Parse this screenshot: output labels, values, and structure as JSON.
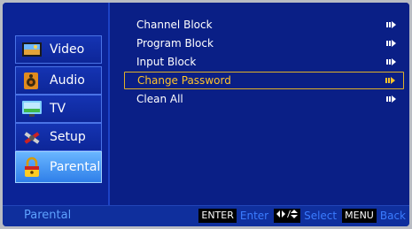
{
  "sidebar": {
    "items": [
      {
        "label": "Video",
        "icon": "video-icon"
      },
      {
        "label": "Audio",
        "icon": "audio-icon"
      },
      {
        "label": "TV",
        "icon": "tv-icon"
      },
      {
        "label": "Setup",
        "icon": "setup-icon"
      },
      {
        "label": "Parental",
        "icon": "parental-lock-icon",
        "active": true
      }
    ]
  },
  "menu": {
    "items": [
      {
        "label": "Channel Block"
      },
      {
        "label": "Program Block"
      },
      {
        "label": "Input Block"
      },
      {
        "label": "Change Password",
        "selected": true
      },
      {
        "label": "Clean All"
      }
    ]
  },
  "footer": {
    "title": "Parental",
    "hints": [
      {
        "key": "ENTER",
        "text": "Enter"
      },
      {
        "key": "◆/◆",
        "text": "Select"
      },
      {
        "key": "MENU",
        "text": "Back"
      }
    ]
  },
  "colors": {
    "accent_selected": "#ffc42b",
    "hint_text": "#3b7cff",
    "background": "#0a1f86"
  }
}
